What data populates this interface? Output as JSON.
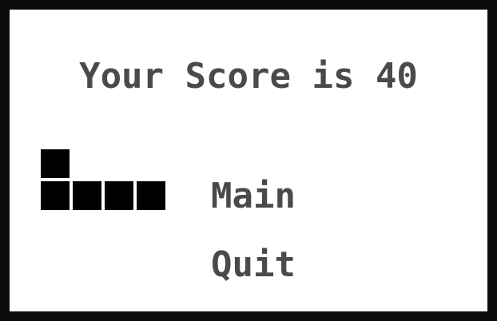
{
  "game": {
    "score_text": "Your Score is 40",
    "score_value": 40,
    "menu": {
      "main_label": "Main",
      "quit_label": "Quit"
    },
    "piece": {
      "name": "tetromino-selector-icon",
      "color": "#000000"
    }
  },
  "colors": {
    "border": "#0b0b0b",
    "background": "#ffffff",
    "text": "#4a4a4a",
    "block": "#000000"
  }
}
